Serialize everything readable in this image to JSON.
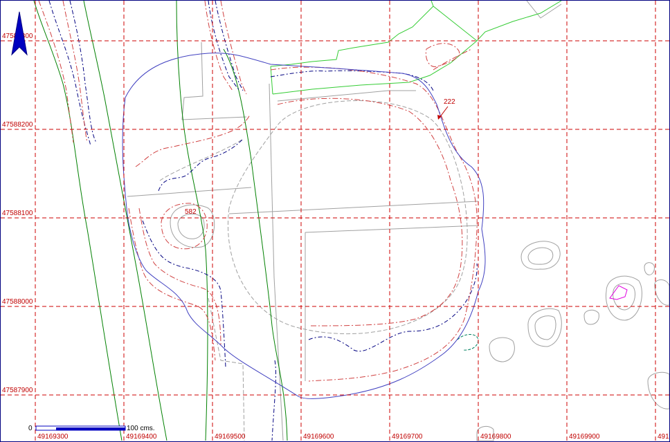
{
  "grid": {
    "x_labels": [
      "49169300",
      "49169400",
      "49169500",
      "49169600",
      "49169700",
      "49169800",
      "49169900",
      "491"
    ],
    "y_labels": [
      "47588300",
      "47588200",
      "47588100",
      "47588000",
      "47587900"
    ]
  },
  "features": {
    "label_222": "222",
    "label_582": "582"
  },
  "scale": {
    "zero": "0",
    "length": "100 cms."
  },
  "colors": {
    "grid": "#cc0000",
    "boundary": "#4040c0",
    "contour_red": "#d04040",
    "contour_blue": "#000080",
    "stream": "#008000",
    "field": "#33cc33",
    "gray": "#a0a0a0"
  },
  "icons": {
    "north": "north-arrow-icon"
  }
}
